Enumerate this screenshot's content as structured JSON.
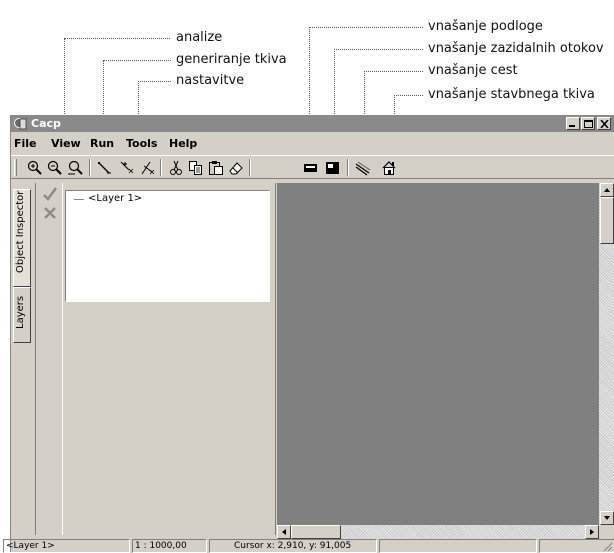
{
  "callouts": {
    "analize": "analize",
    "generiranje": "generiranje tkiva",
    "nastavitve": "nastavitve",
    "podloge": "vnašanje podloge",
    "otokov": "vnašanje zazidalnih otokov",
    "cest": "vnašanje cest",
    "stavbnega": "vnašanje stavbnega tkiva"
  },
  "window": {
    "title": "Cacp"
  },
  "menu": [
    "File",
    "View",
    "Run",
    "Tools",
    "Help"
  ],
  "toolbar": {
    "icons": [
      "zoom-in-icon",
      "zoom-out-icon",
      "zoom-fit-icon",
      "draw-line-icon",
      "edit-vertex-icon",
      "delete-vertex-icon",
      "cut-icon",
      "copy-icon",
      "paste-icon",
      "eraser-icon",
      "underlay-icon",
      "block-island-icon",
      "road-icon",
      "building-icon"
    ]
  },
  "tabs": {
    "object_inspector": "Object Inspector",
    "layers": "Layers"
  },
  "layers": {
    "items": [
      "<Layer 1>"
    ]
  },
  "status": {
    "layer": "<Layer 1>",
    "scale": "1 : 1000,00",
    "cursor": "Cursor x: 2,910, y: 91,005"
  },
  "colors": {
    "titlebar": "#8a8a8a",
    "face": "#d4d0c8",
    "canvas": "#808080"
  }
}
